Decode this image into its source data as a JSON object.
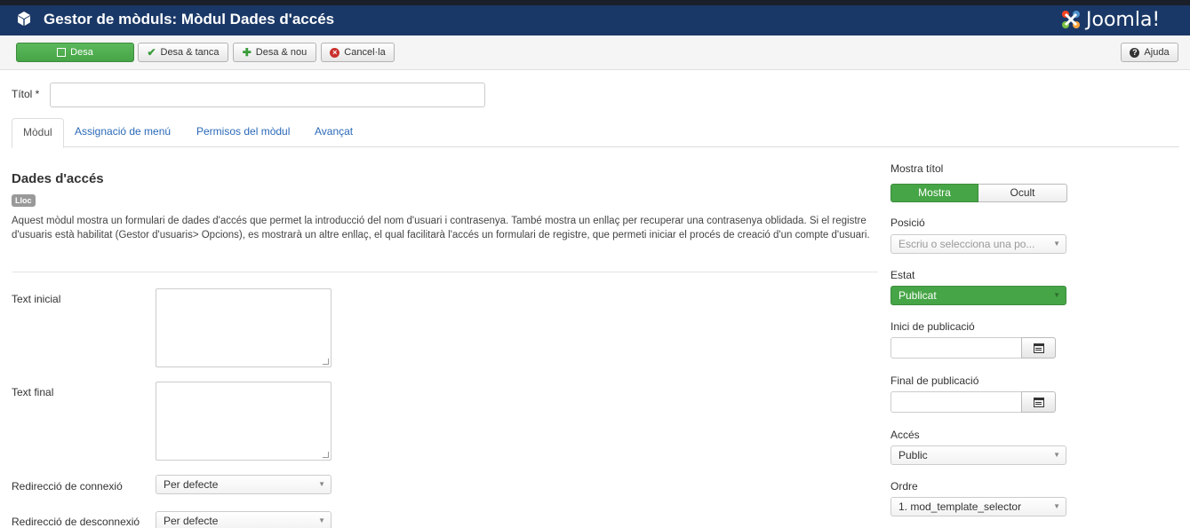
{
  "header": {
    "title": "Gestor de mòduls: Mòdul Dades d'accés",
    "cube_icon": "cube-icon",
    "brand": "Joomla!"
  },
  "toolbar": {
    "save": "Desa",
    "save_close": "Desa & tanca",
    "save_new": "Desa & nou",
    "cancel": "Cancel·la",
    "help": "Ajuda"
  },
  "title_field": {
    "label": "Títol *",
    "value": ""
  },
  "tabs": [
    {
      "label": "Mòdul",
      "active": true
    },
    {
      "label": "Assignació de menú",
      "active": false
    },
    {
      "label": "Permisos del mòdul",
      "active": false
    },
    {
      "label": "Avançat",
      "active": false
    }
  ],
  "module": {
    "title": "Dades d'accés",
    "badge": "Lloc",
    "description": "Aquest mòdul mostra un formulari de dades d'accés que permet la introducció del nom d'usuari i contrasenya. També mostra un enllaç per recuperar una contrasenya oblidada. Si el registre d'usuaris està habilitat (Gestor d'usuaris> Opcions), es mostrarà un altre enllaç, el qual facilitarà l'accés un formulari de registre, que permeti iniciar el procés de creació d'un compte d'usuari."
  },
  "fields": {
    "pretext_label": "Text inicial",
    "posttext_label": "Text final",
    "login_redirect_label": "Redirecció de connexió",
    "login_redirect_value": "Per defecte",
    "logout_redirect_label": "Redirecció de desconnexió",
    "logout_redirect_value": "Per defecte"
  },
  "sidebar": {
    "show_title_label": "Mostra títol",
    "show_title_on": "Mostra",
    "show_title_off": "Ocult",
    "position_label": "Posició",
    "position_placeholder": "Escriu o selecciona una po...",
    "status_label": "Estat",
    "status_value": "Publicat",
    "publish_up_label": "Inici de publicació",
    "publish_down_label": "Final de publicació",
    "access_label": "Accés",
    "access_value": "Public",
    "ordering_label": "Ordre",
    "ordering_value": "1. mod_template_selector"
  },
  "colors": {
    "header_bg": "#1a3867",
    "accent_green": "#46a546",
    "link_blue": "#2a69b8"
  }
}
